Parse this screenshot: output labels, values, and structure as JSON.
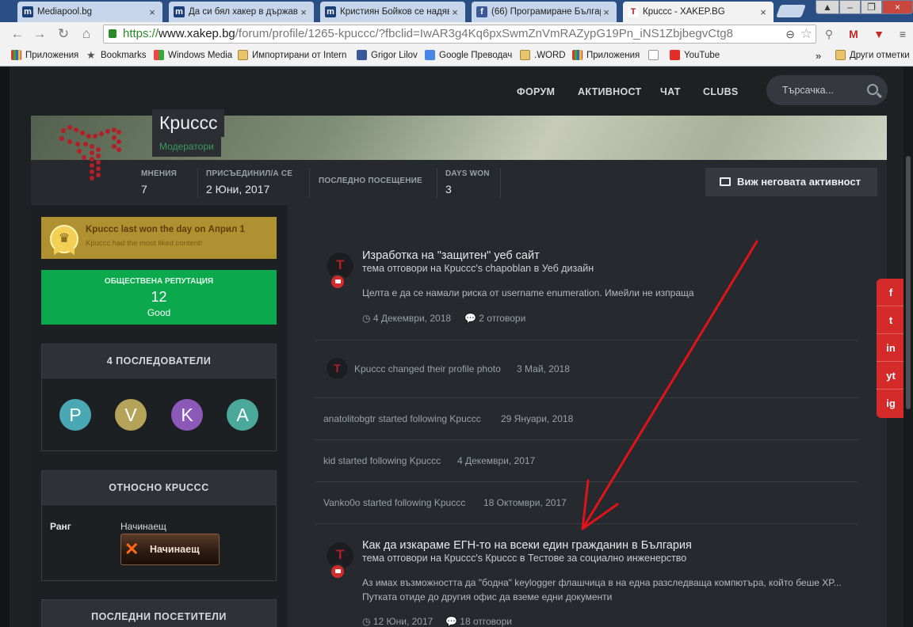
{
  "browser": {
    "tabs": [
      {
        "label": "Mediapool.bg",
        "icon": "m",
        "color": "#1a3f78"
      },
      {
        "label": "Да си бял хакер в държав…",
        "icon": "m",
        "color": "#1a3f78"
      },
      {
        "label": "Кристиян Бойков се надяв…",
        "icon": "m",
        "color": "#1a3f78"
      },
      {
        "label": "(66) Програмиране Българ…",
        "icon": "f",
        "color": "#3b5998"
      },
      {
        "label": "Крuccc - XAKEP.BG",
        "icon": "T",
        "color": "#b41e24"
      }
    ],
    "url_scheme": "https://",
    "url_domain": "www.xakep.bg",
    "url_path": "/forum/profile/1265-kpuccc/?fbclid=IwAR3g4Kq6pxSwmZnVmRAZypG19Pn_iNS1ZbjbegvCtg8",
    "bookmarks": [
      {
        "label": "Приложения",
        "icon": "grid"
      },
      {
        "label": "Bookmarks",
        "icon": "star"
      },
      {
        "label": "Windows Media",
        "icon": "win"
      },
      {
        "label": "Импортирани от Intern",
        "icon": "folder"
      },
      {
        "label": "Grigor Lilov",
        "icon": "fb"
      },
      {
        "label": "Google Преводач",
        "icon": "gt"
      },
      {
        "label": ".WORD",
        "icon": "folder"
      },
      {
        "label": "Приложения",
        "icon": "grid"
      },
      {
        "label": "",
        "icon": "page"
      },
      {
        "label": "YouTube",
        "icon": "yt"
      },
      {
        "label": "Други отметки",
        "icon": "folder"
      }
    ],
    "more_bookmarks": "»"
  },
  "nav": {
    "items": [
      "ФОРУМ",
      "АКТИВНОСТ",
      "ЧАТ",
      "CLUBS"
    ],
    "search_placeholder": "Търсачка..."
  },
  "profile": {
    "name": "Крuccc",
    "group": "Модератори",
    "stats": [
      {
        "label": "МНЕНИЯ",
        "value": "7"
      },
      {
        "label": "ПРИСЪЕДИНИЛ/А СЕ",
        "value": "2 Юни, 2017"
      },
      {
        "label": "ПОСЛЕДНО ПОСЕЩЕНИЕ",
        "value": ""
      },
      {
        "label": "DAYS WON",
        "value": "3"
      }
    ],
    "activity_button": "Виж неговата активност"
  },
  "sidebar": {
    "award_title": "Kpuccc last won the day on Април 1",
    "award_sub": "Kpuccc had the most liked content!",
    "rep_label": "ОБЩЕСТВЕНА РЕПУТАЦИЯ",
    "rep_value": "12",
    "rep_word": "Good",
    "followers_title": "4 ПОСЛЕДОВАТЕЛИ",
    "followers": [
      {
        "letter": "P",
        "color": "#49a8b3"
      },
      {
        "letter": "V",
        "color": "#b6a35a"
      },
      {
        "letter": "K",
        "color": "#8c59b8"
      },
      {
        "letter": "A",
        "color": "#4aa99a"
      }
    ],
    "about_title": "ОТНОСНО КРUCCC",
    "rank_label": "Ранг",
    "rank_value": "Начинаещ",
    "rank_badge": "Начинаещ",
    "visitors_title": "ПОСЛЕДНИ ПОСЕТИТЕЛИ"
  },
  "feed": {
    "post1": {
      "title": "Изработка на \"защитен\" уеб сайт",
      "sub": "тема отговори на Крuccc's chapoblan в Уеб дизайн",
      "body": "Целта е да се намали риска от username enumeration. Имейли не изпраща",
      "date": "4 Декември, 2018",
      "replies": "2 отговори"
    },
    "photo_change": "Kpuccc changed their profile photo",
    "photo_date": "3 Май, 2018",
    "follows": [
      {
        "text": "anatolitobgtr started following Kpuccc",
        "date": "29 Януари, 2018"
      },
      {
        "text": "kid started following Kpuccc",
        "date": "4 Декември, 2017"
      },
      {
        "text": "Vanko0o started following Kpuccc",
        "date": "18 Октомври, 2017"
      }
    ],
    "post2": {
      "title": "Как да изкараме ЕГН-то на всеки един гражданин в България",
      "sub": "тема отговори на Крuccc's Крuccc в Тестове за социално инженерство",
      "body1": "Аз имах възможността да \"бодна\" keylogger флашчица в на една разследваща компютъра, който беше XP...",
      "body2": "Путката отиде до другия офис да вземе едни документи",
      "date": "12 Юни, 2017",
      "replies": "18 отговори"
    }
  },
  "social": [
    "f",
    "t",
    "in",
    "yt",
    "ig"
  ],
  "colors": {
    "accent": "#0ba84e",
    "social": "#d42a2a",
    "award": "#b09131"
  }
}
